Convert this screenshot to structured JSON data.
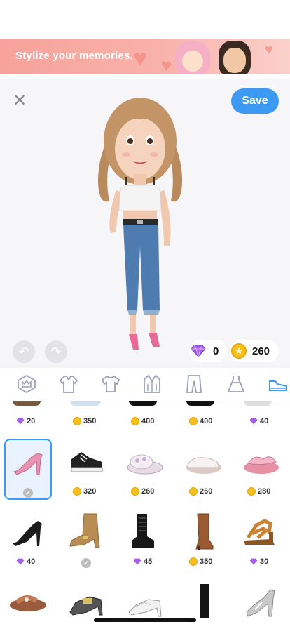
{
  "banner": {
    "text": "Stylize your memories."
  },
  "editor": {
    "save_label": "Save",
    "close_icon": "close-icon",
    "undo_icon": "undo-icon",
    "redo_icon": "redo-icon"
  },
  "wallet": {
    "gems": "0",
    "coins": "260"
  },
  "categories": [
    {
      "name": "premium",
      "icon": "crown-icon"
    },
    {
      "name": "outerwear",
      "icon": "jacket-icon"
    },
    {
      "name": "tops",
      "icon": "tshirt-icon"
    },
    {
      "name": "coats",
      "icon": "coat-icon"
    },
    {
      "name": "bottoms",
      "icon": "pants-icon"
    },
    {
      "name": "dresses",
      "icon": "dress-icon"
    },
    {
      "name": "shoes",
      "icon": "shoe-icon",
      "active": true
    }
  ],
  "grid": {
    "row0": [
      {
        "currency": "gem",
        "price": "20"
      },
      {
        "currency": "coin",
        "price": "350"
      },
      {
        "currency": "coin",
        "price": "400"
      },
      {
        "currency": "coin",
        "price": "400"
      },
      {
        "currency": "gem",
        "price": "40"
      }
    ],
    "row1": [
      {
        "currency": "owned",
        "price": "",
        "name": "pink pumps"
      },
      {
        "currency": "coin",
        "price": "320",
        "name": "black sneakers"
      },
      {
        "currency": "coin",
        "price": "260",
        "name": "fluffy slippers"
      },
      {
        "currency": "coin",
        "price": "260",
        "name": "white slippers"
      },
      {
        "currency": "coin",
        "price": "280",
        "name": "pink slides"
      }
    ],
    "row2": [
      {
        "currency": "gem",
        "price": "40",
        "name": "black pumps"
      },
      {
        "currency": "owned",
        "price": "",
        "name": "tan booties"
      },
      {
        "currency": "gem",
        "price": "45",
        "name": "combat boots"
      },
      {
        "currency": "coin",
        "price": "350",
        "name": "brown boots"
      },
      {
        "currency": "gem",
        "price": "30",
        "name": "tan sandals"
      }
    ]
  },
  "colors": {
    "accent": "#3d9af3",
    "banner": "#f6a29a",
    "coin": "#f6c01b",
    "gem": "#9b4de0"
  }
}
